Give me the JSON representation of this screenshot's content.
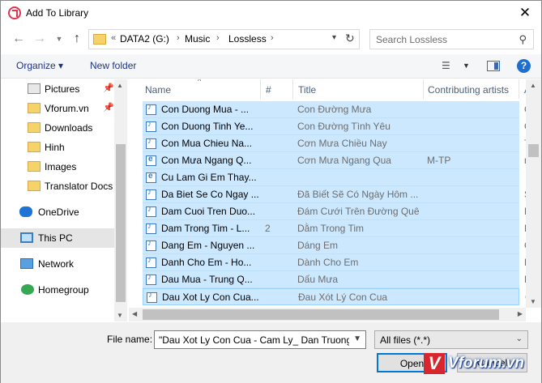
{
  "window": {
    "title": "Add To Library"
  },
  "nav": {
    "address": [
      "DATA2 (G:)",
      "Music",
      "Lossless"
    ],
    "overflow": "«",
    "search_placeholder": "Search Lossless"
  },
  "toolbar": {
    "organize": "Organize ▾",
    "new_folder": "New folder",
    "help": "?"
  },
  "sidebar": {
    "items": [
      {
        "label": "Pictures",
        "icon": "pictures-icon",
        "pinned": true
      },
      {
        "label": "Vforum.vn",
        "icon": "folder-icon",
        "pinned": true
      },
      {
        "label": "Downloads",
        "icon": "folder-icon",
        "pinned": false
      },
      {
        "label": "Hinh",
        "icon": "folder-icon",
        "pinned": false
      },
      {
        "label": "Images",
        "icon": "folder-icon",
        "pinned": false
      },
      {
        "label": "Translator Docs",
        "icon": "folder-icon",
        "pinned": false
      },
      {
        "label": "OneDrive",
        "icon": "onedrive-icon",
        "pinned": false
      },
      {
        "label": "This PC",
        "icon": "pc-icon",
        "pinned": false,
        "selected": true
      },
      {
        "label": "Network",
        "icon": "network-icon",
        "pinned": false
      },
      {
        "label": "Homegroup",
        "icon": "homegroup-icon",
        "pinned": false
      }
    ]
  },
  "columns": {
    "name": "Name",
    "num": "#",
    "title": "Title",
    "artist": "Contributing artists",
    "extra": "A"
  },
  "files": [
    {
      "name": "Con Duong Mua - ...",
      "num": "",
      "title": "Con Đường Mưa",
      "artist": "",
      "extra": "C",
      "icon": "audio"
    },
    {
      "name": "Con Duong Tinh Ye...",
      "num": "",
      "title": "Con Đường Tình Yêu",
      "artist": "",
      "extra": "C",
      "icon": "audio"
    },
    {
      "name": "Con Mua Chieu Na...",
      "num": "",
      "title": "Cơn Mưa Chiều Nay",
      "artist": "",
      "extra": "T",
      "icon": "audio"
    },
    {
      "name": "Con Mưa Ngang Q...",
      "num": "",
      "title": "Cơn Mưa Ngang Qua",
      "artist": "M-TP",
      "extra": "n",
      "icon": "web"
    },
    {
      "name": "Cu Lam Gi Em Thay...",
      "num": "",
      "title": "",
      "artist": "",
      "extra": "",
      "icon": "web"
    },
    {
      "name": "Da Biet Se Co Ngay ...",
      "num": "",
      "title": "Đã Biết Sẽ Có Ngày Hôm ...",
      "artist": "",
      "extra": "S",
      "icon": "audio"
    },
    {
      "name": "Dam Cuoi Tren Duo...",
      "num": "",
      "title": "Đám Cưới Trên Đường Quê",
      "artist": "",
      "extra": "H",
      "icon": "audio"
    },
    {
      "name": "Dam Trong Tim - L...",
      "num": "2",
      "title": "Dằm Trong Tim",
      "artist": "",
      "extra": "H",
      "icon": "audio"
    },
    {
      "name": "Dang Em - Nguyen ...",
      "num": "",
      "title": "Dáng Em",
      "artist": "",
      "extra": "C",
      "icon": "audio"
    },
    {
      "name": "Danh Cho Em - Ho...",
      "num": "",
      "title": "Dành Cho Em",
      "artist": "",
      "extra": "H",
      "icon": "audio"
    },
    {
      "name": "Dau Mua - Trung Q...",
      "num": "",
      "title": "Dấu Mưa",
      "artist": "",
      "extra": "D",
      "icon": "audio"
    },
    {
      "name": "Dau Xot Ly Con Cua...",
      "num": "",
      "title": "Đau Xót Lý Con Cua",
      "artist": "",
      "extra": "C",
      "icon": "audio"
    }
  ],
  "bottom": {
    "file_name_label": "File name:",
    "file_name_value": "\"Dau Xot Ly Con Cua - Cam Ly_ Dan Truong [",
    "file_type": "All files (*.*)",
    "open_label": "Open",
    "cancel_label": "Cancel"
  },
  "watermark": {
    "letter": "V",
    "text": "Vforum.vn"
  }
}
